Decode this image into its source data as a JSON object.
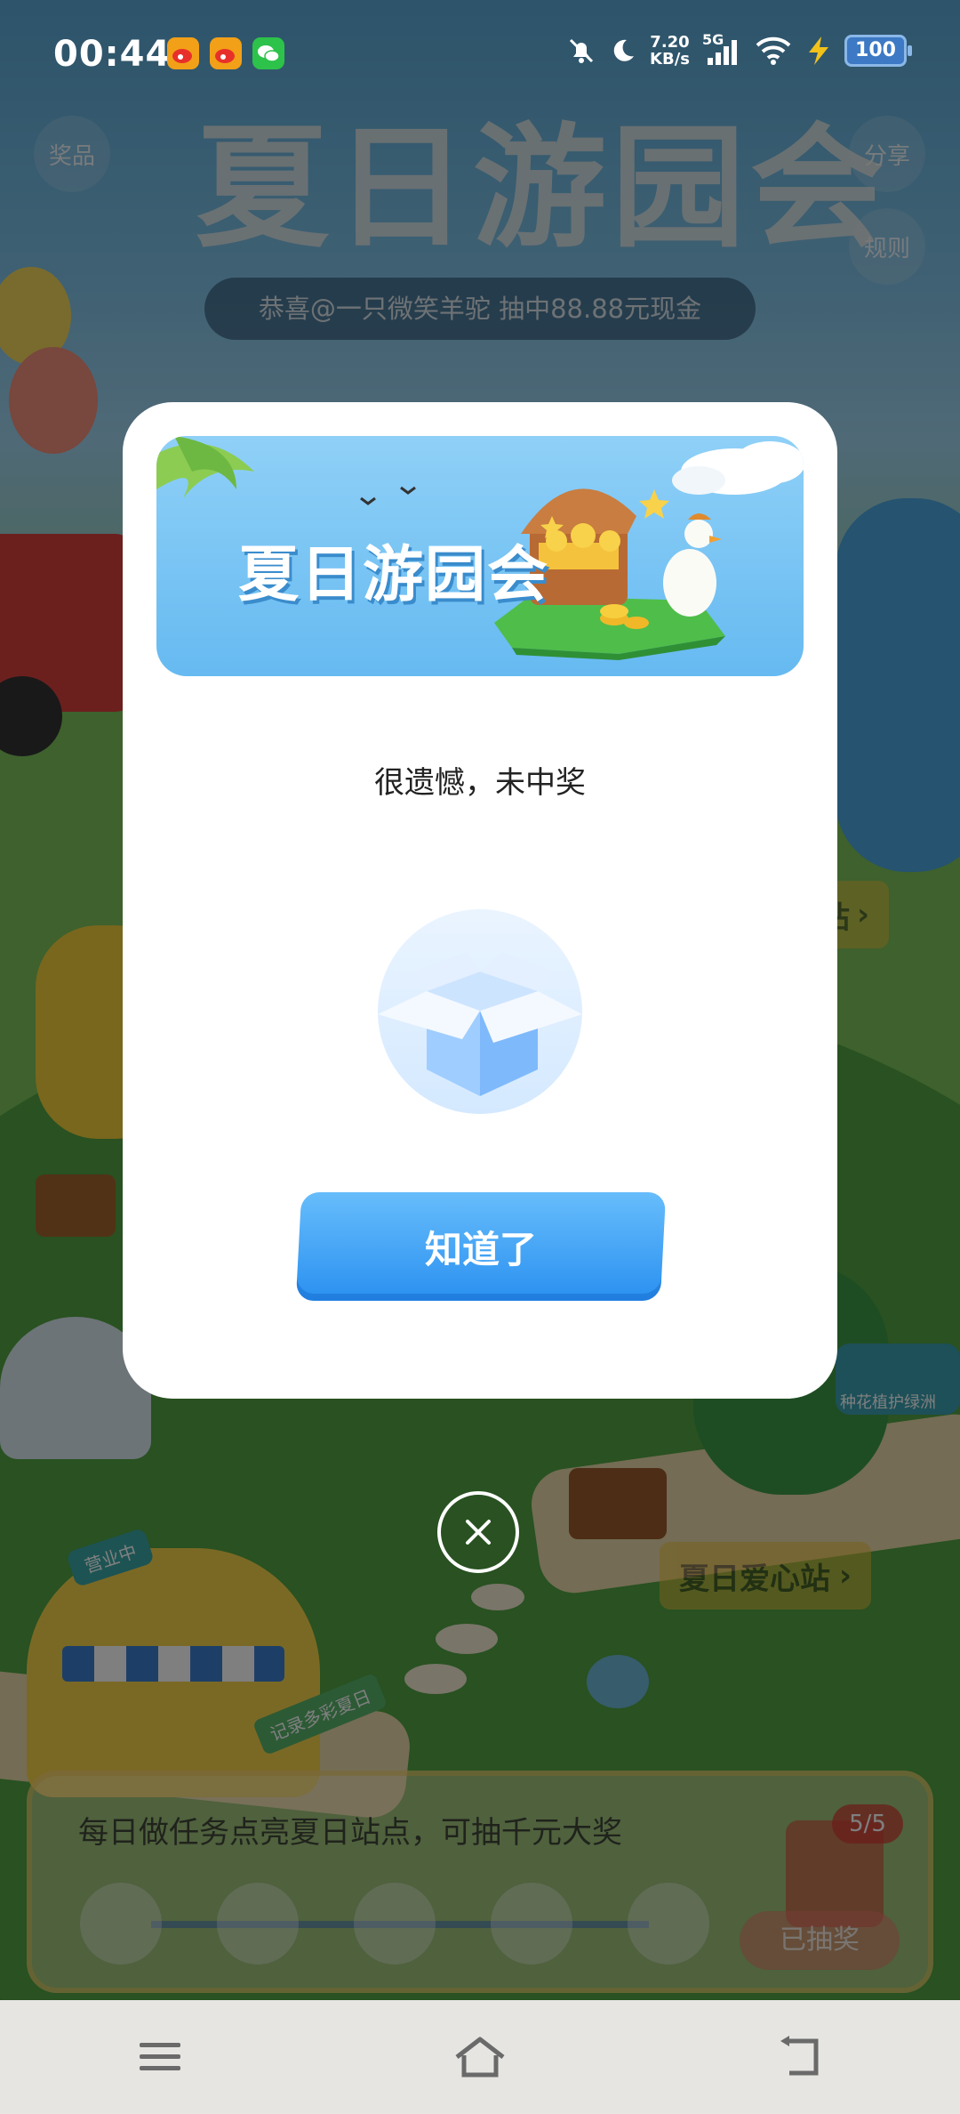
{
  "status_bar": {
    "time": "00:44",
    "net_speed_value": "7.20",
    "net_speed_unit": "KB/s",
    "network_type": "5G",
    "battery": "100",
    "icons": [
      "weibo-icon",
      "weibo-icon",
      "wechat-icon",
      "mute-icon",
      "moon-icon",
      "signal-icon",
      "wifi-icon",
      "charging-icon",
      "battery-icon"
    ]
  },
  "header": {
    "prizes_label": "奖品",
    "share_label": "分享",
    "rules_label": "规则",
    "title": "夏日游园会",
    "ticker": "恭喜@一只微笑羊驼 抽中88.88元现金"
  },
  "scene": {
    "station_sign_1": "站",
    "station_sign_2": "夏日爱心站",
    "shop_badge": "营业中",
    "record_tag": "记录多彩夏日",
    "mailbox_label": "种花植护绿洲"
  },
  "task_bar": {
    "title": "每日做任务点亮夏日站点，可抽千元大奖",
    "progress_count": "5/5",
    "drawn_label": "已抽奖"
  },
  "modal": {
    "banner_title": "夏日游园会",
    "message": "很遗憾，未中奖",
    "confirm_label": "知道了"
  },
  "colors": {
    "accent_blue": "#2A90F0",
    "modal_bg": "#FFFFFF",
    "overlay": "rgba(0,0,0,0.5)"
  }
}
